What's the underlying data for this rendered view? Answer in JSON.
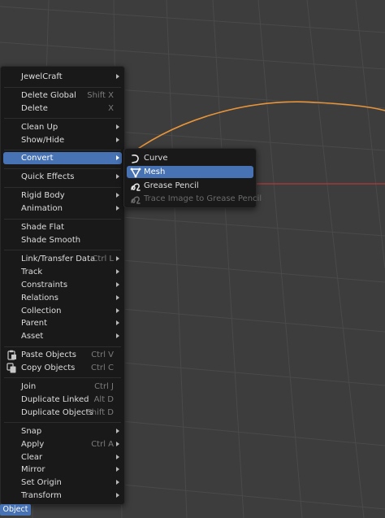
{
  "object_menu": {
    "items": [
      {
        "label": "JewelCraft",
        "shortcut": "",
        "submenu": true
      },
      {
        "label": "Delete Global",
        "shortcut": "Shift X",
        "submenu": false
      },
      {
        "label": "Delete",
        "shortcut": "X",
        "submenu": false
      },
      {
        "label": "Clean Up",
        "shortcut": "",
        "submenu": true
      },
      {
        "label": "Show/Hide",
        "shortcut": "",
        "submenu": true
      },
      {
        "label": "Convert",
        "shortcut": "",
        "submenu": true,
        "active": true
      },
      {
        "label": "Quick Effects",
        "shortcut": "",
        "submenu": true
      },
      {
        "label": "Rigid Body",
        "shortcut": "",
        "submenu": true
      },
      {
        "label": "Animation",
        "shortcut": "",
        "submenu": true
      },
      {
        "label": "Shade Flat",
        "shortcut": "",
        "submenu": false
      },
      {
        "label": "Shade Smooth",
        "shortcut": "",
        "submenu": false
      },
      {
        "label": "Link/Transfer Data",
        "shortcut": "Ctrl L",
        "submenu": true
      },
      {
        "label": "Track",
        "shortcut": "",
        "submenu": true
      },
      {
        "label": "Constraints",
        "shortcut": "",
        "submenu": true
      },
      {
        "label": "Relations",
        "shortcut": "",
        "submenu": true
      },
      {
        "label": "Collection",
        "shortcut": "",
        "submenu": true
      },
      {
        "label": "Parent",
        "shortcut": "",
        "submenu": true
      },
      {
        "label": "Asset",
        "shortcut": "",
        "submenu": true
      },
      {
        "label": "Paste Objects",
        "shortcut": "Ctrl V",
        "submenu": false,
        "icon": "paste-icon"
      },
      {
        "label": "Copy Objects",
        "shortcut": "Ctrl C",
        "submenu": false,
        "icon": "copy-icon"
      },
      {
        "label": "Join",
        "shortcut": "Ctrl J",
        "submenu": false
      },
      {
        "label": "Duplicate Linked",
        "shortcut": "Alt D",
        "submenu": false
      },
      {
        "label": "Duplicate Objects",
        "shortcut": "Shift D",
        "submenu": false
      },
      {
        "label": "Snap",
        "shortcut": "",
        "submenu": true
      },
      {
        "label": "Apply",
        "shortcut": "Ctrl A",
        "submenu": true
      },
      {
        "label": "Clear",
        "shortcut": "",
        "submenu": true
      },
      {
        "label": "Mirror",
        "shortcut": "",
        "submenu": true
      },
      {
        "label": "Set Origin",
        "shortcut": "",
        "submenu": true
      },
      {
        "label": "Transform",
        "shortcut": "",
        "submenu": true
      }
    ]
  },
  "convert_submenu": {
    "items": [
      {
        "label": "Curve",
        "icon": "curve-icon",
        "active": false,
        "disabled": false
      },
      {
        "label": "Mesh",
        "icon": "mesh-icon",
        "active": true,
        "disabled": false
      },
      {
        "label": "Grease Pencil",
        "icon": "grease-pencil-icon",
        "active": false,
        "disabled": false
      },
      {
        "label": "Trace Image to Grease Pencil",
        "icon": "trace-image-icon",
        "active": false,
        "disabled": true
      }
    ]
  },
  "header": {
    "mode_label": "Object"
  },
  "colors": {
    "menu_bg": "#191919",
    "highlight": "#4772b3",
    "viewport_bg": "#3d3d3d",
    "curve": "#e8953a",
    "x_axis": "#b23b3b"
  }
}
